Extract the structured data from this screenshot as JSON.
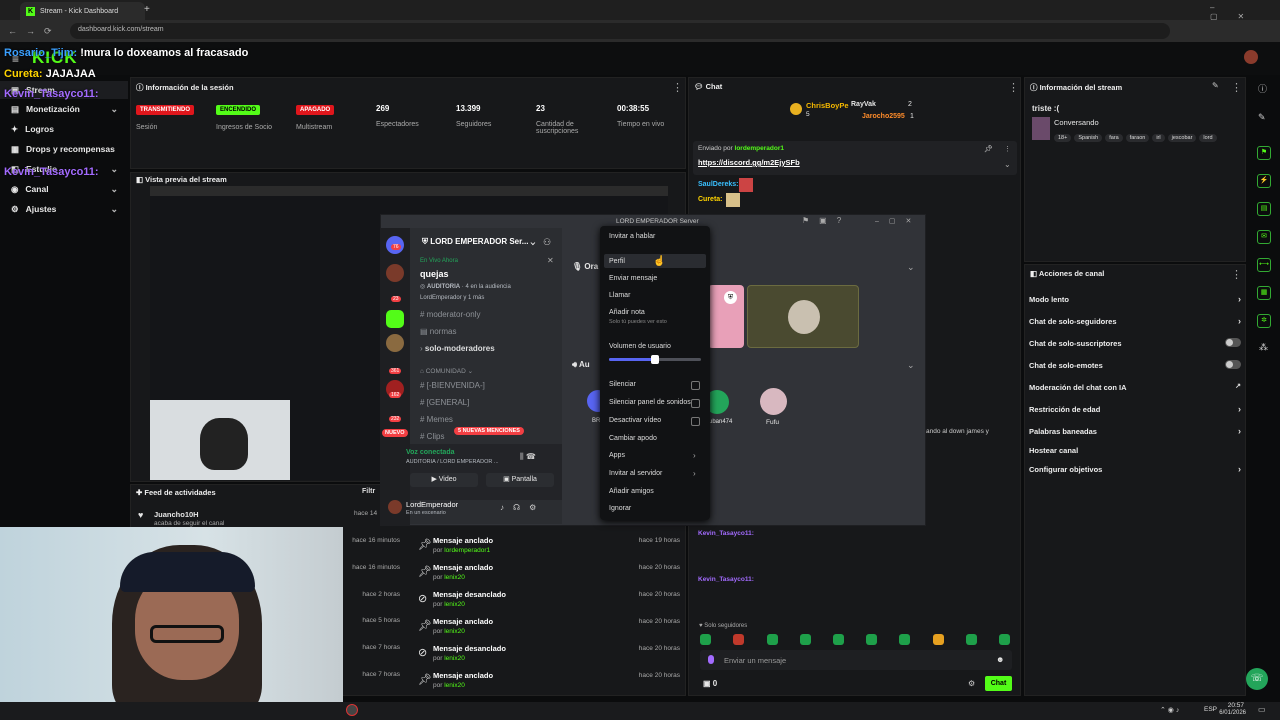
{
  "browser": {
    "tab_title": "Stream - Kick Dashboard",
    "url": "dashboard.kick.com/stream"
  },
  "overlay": {
    "line1_user": "Rosario_Tijm:",
    "line1_msg": "!mura lo doxeamos al fracasado",
    "line2_user": "Cureta:",
    "line2_msg": "JAJAJAA",
    "line3_user": "Kevin_Tasayco11:",
    "line4_user": "Kevin_Tasayco11:"
  },
  "sidebar": {
    "items": [
      {
        "label": "Stream"
      },
      {
        "label": "Monetización"
      },
      {
        "label": "Logros"
      },
      {
        "label": "Drops y recompensas"
      },
      {
        "label": "Estudio"
      },
      {
        "label": "Canal"
      },
      {
        "label": "Ajustes"
      }
    ]
  },
  "session": {
    "title": "Información de la sesión",
    "stats": [
      {
        "badge": "TRANSMITIENDO",
        "badge_color": "#e0161c",
        "label": "Sesión"
      },
      {
        "badge": "ENCENDIDO",
        "badge_color": "#53fc18",
        "label": "Ingresos de Socio"
      },
      {
        "badge": "APAGADO",
        "badge_color": "#e0161c",
        "label": "Multistream"
      },
      {
        "value": "269",
        "label": "Espectadores"
      },
      {
        "value": "13.399",
        "label": "Seguidores"
      },
      {
        "value": "23",
        "label": "Cantidad de suscripciones"
      },
      {
        "value": "00:38:55",
        "label": "Tiempo en vivo"
      }
    ]
  },
  "preview": {
    "title": "Vista previa del stream"
  },
  "activity": {
    "title": "Feed de actividades",
    "filter": "Filtr",
    "first": {
      "user": "Juancho10H",
      "desc": "acaba de seguir el canal",
      "time": "hace 14"
    },
    "left_times": [
      "hace 16 minutos",
      "hace 16 minutos",
      "hace 2 horas",
      "hace 5 horas",
      "hace 7 horas",
      "hace 7 horas"
    ],
    "rows": [
      {
        "title": "Mensaje anclado",
        "by": "lordemperador1",
        "time": "hace 19 horas"
      },
      {
        "title": "Mensaje anclado",
        "by": "lenix20",
        "time": "hace 20 horas"
      },
      {
        "title": "Mensaje desanclado",
        "by": "lenix20",
        "time": "hace 20 horas"
      },
      {
        "title": "Mensaje anclado",
        "by": "lenix20",
        "time": "hace 20 horas"
      },
      {
        "title": "Mensaje desanclado",
        "by": "lenix20",
        "time": "hace 20 horas"
      },
      {
        "title": "Mensaje anclado",
        "by": "lenix20",
        "time": "hace 20 horas"
      }
    ],
    "by_prefix": "por"
  },
  "chat": {
    "title": "Chat",
    "top": [
      {
        "name": "ChrisBoyPe",
        "count": "5"
      },
      {
        "name": "RayVak",
        "count": "2"
      },
      {
        "name": "Jarocho2595",
        "count": "1"
      }
    ],
    "pinned_by_label": "Enviado por",
    "pinned_by": "lordemperador1",
    "pinned_link": "https://discord.gg/m2EjySFb",
    "msgs": [
      {
        "user": "SaulDereks:"
      },
      {
        "user": "Cureta:"
      }
    ],
    "bottom_users": [
      "Kevin_Tasayco11:",
      "Kevin_Tasayco11:"
    ],
    "followers_only": "Solo seguidores",
    "placeholder": "Enviar un mensaje",
    "count": "0",
    "send": "Chat",
    "side_text": "ando al down james y"
  },
  "stream_info": {
    "title": "Información del stream",
    "stream_title": "triste :(",
    "category": "Conversando",
    "tags": [
      "18+",
      "Spanish",
      "fara",
      "faraon",
      "irl",
      "jescobar",
      "lord"
    ]
  },
  "channel_actions": {
    "title": "Acciones de canal",
    "items": [
      {
        "label": "Modo lento",
        "kind": "arrow"
      },
      {
        "label": "Chat de solo-seguidores",
        "kind": "arrow"
      },
      {
        "label": "Chat de solo-suscriptores",
        "kind": "toggle"
      },
      {
        "label": "Chat de solo-emotes",
        "kind": "toggle"
      },
      {
        "label": "Moderación del chat con IA",
        "kind": "ext"
      },
      {
        "label": "Restricción de edad",
        "kind": "arrow"
      },
      {
        "label": "Palabras baneadas",
        "kind": "arrow"
      },
      {
        "label": "Hostear canal",
        "kind": "none"
      },
      {
        "label": "Configurar objetivos",
        "kind": "arrow"
      }
    ]
  },
  "discord": {
    "server": "LORD EMPERADOR Ser...",
    "window_title": "LORD EMPERADOR Server",
    "live": "En Vivo Ahora",
    "stage": "quejas",
    "audience": "AUDITORIA",
    "audience_count": "4 en la audiencia",
    "speakers": "LordEmperador y 1 más",
    "channels": [
      "moderator-only",
      "normas",
      "solo-moderadores"
    ],
    "category": "COMUNIDAD",
    "channels2": [
      "[-BIENVENIDA-]",
      "[GENERAL]",
      "Memes",
      "Clips"
    ],
    "mentions": "5 NUEVAS MENCIONES",
    "new": "NUEVO",
    "voice": "Voz conectada",
    "voice_sub": "AUDITORIA / LORD EMPERADOR ...",
    "video_btn": "Video",
    "screen_btn": "Pantalla",
    "user": "LordEmperador",
    "user_status": "En un escenario",
    "stage_label": "Ora",
    "aud_label": "Au",
    "participants": [
      "BR",
      "uban474",
      "Fufu"
    ],
    "badges": [
      "76",
      "23",
      "361",
      "162",
      "232"
    ]
  },
  "context_menu": {
    "items": [
      "Invitar a hablar",
      "Perfil",
      "Enviar mensaje",
      "Llamar",
      "Añadir nota",
      "Volumen de usuario",
      "Silenciar",
      "Silenciar panel de sonidos",
      "Desactivar vídeo",
      "Cambiar apodo",
      "Apps",
      "Invitar al servidor",
      "Añadir amigos",
      "Ignorar"
    ],
    "note_sub": "Solo tú puedes ver esto"
  },
  "taskbar": {
    "lang": "ESP",
    "time": "20:57",
    "date": "6/01/2026"
  }
}
